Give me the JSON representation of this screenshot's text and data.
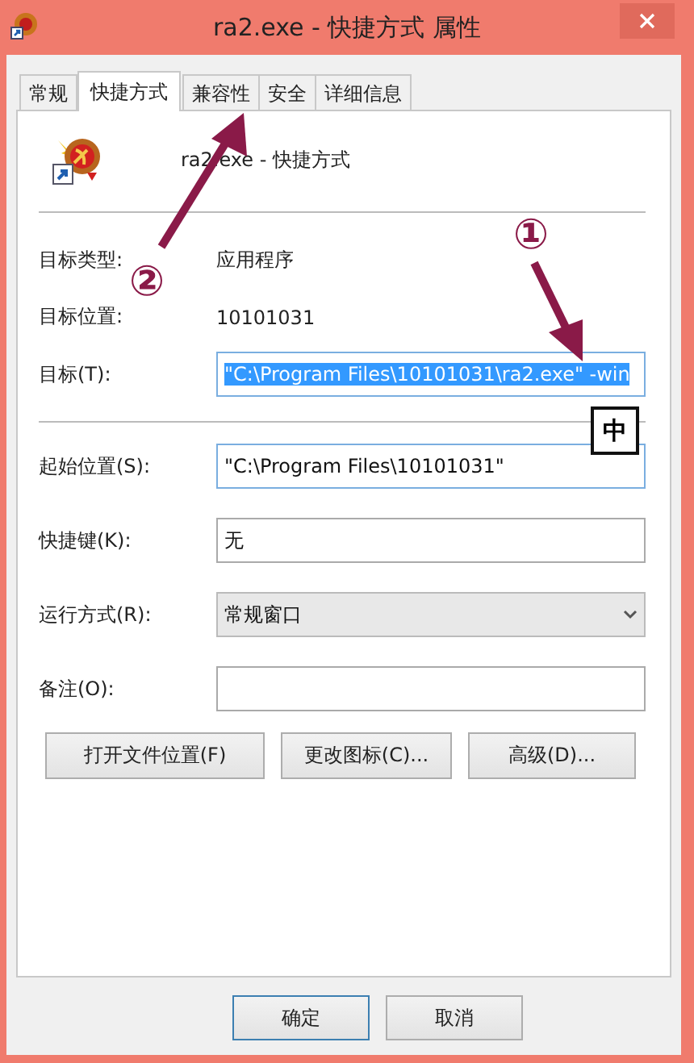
{
  "window": {
    "title": "ra2.exe - 快捷方式 属性"
  },
  "tabs": [
    {
      "label": "常规",
      "selected": false
    },
    {
      "label": "快捷方式",
      "selected": true
    },
    {
      "label": "兼容性",
      "selected": false
    },
    {
      "label": "安全",
      "selected": false
    },
    {
      "label": "详细信息",
      "selected": false
    }
  ],
  "shortcut": {
    "name": "ra2.exe - 快捷方式"
  },
  "info": [
    {
      "label": "目标类型:",
      "value": "应用程序"
    },
    {
      "label": "目标位置:",
      "value": "10101031"
    }
  ],
  "target": {
    "label": "目标(T):",
    "value": "\"C:\\Program Files\\10101031\\ra2.exe\" -win",
    "selected": true
  },
  "fields": [
    {
      "kind": "text",
      "label": "起始位置(S):",
      "value": "\"C:\\Program Files\\10101031\""
    },
    {
      "kind": "text",
      "label": "快捷键(K):",
      "value": "无"
    },
    {
      "kind": "select",
      "label": "运行方式(R):",
      "value": "常规窗口"
    },
    {
      "kind": "text",
      "label": "备注(O):"
    }
  ],
  "action_buttons": [
    "打开文件位置(F)",
    "更改图标(C)...",
    "高级(D)..."
  ],
  "ime_indicator": "中",
  "annotations": [
    {
      "number": "①"
    },
    {
      "number": "②"
    }
  ],
  "dialog_buttons": [
    {
      "label": "确定",
      "default": true
    },
    {
      "label": "取消",
      "default": false
    }
  ]
}
